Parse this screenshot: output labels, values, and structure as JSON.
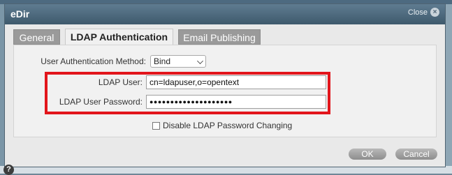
{
  "dialog": {
    "title": "eDir",
    "close_label": "Close",
    "close_icon_glyph": "×"
  },
  "tabs": [
    {
      "label": "General",
      "active": false
    },
    {
      "label": "LDAP Authentication",
      "active": true
    },
    {
      "label": "Email Publishing",
      "active": false
    }
  ],
  "form": {
    "auth_method_label": "User Authentication Method:",
    "auth_method_value": "Bind",
    "ldap_user_label": "LDAP User:",
    "ldap_user_value": "cn=ldapuser,o=opentext",
    "ldap_password_label": "LDAP User Password:",
    "ldap_password_value": "●●●●●●●●●●●●●●●●●●●●",
    "disable_checkbox_label": "Disable LDAP Password Changing",
    "disable_checkbox_checked": false
  },
  "footer": {
    "help_glyph": "?",
    "ok_label": "OK",
    "cancel_label": "Cancel"
  },
  "colors": {
    "highlight": "#e2151b",
    "titlebar": "#4f6a7e"
  }
}
